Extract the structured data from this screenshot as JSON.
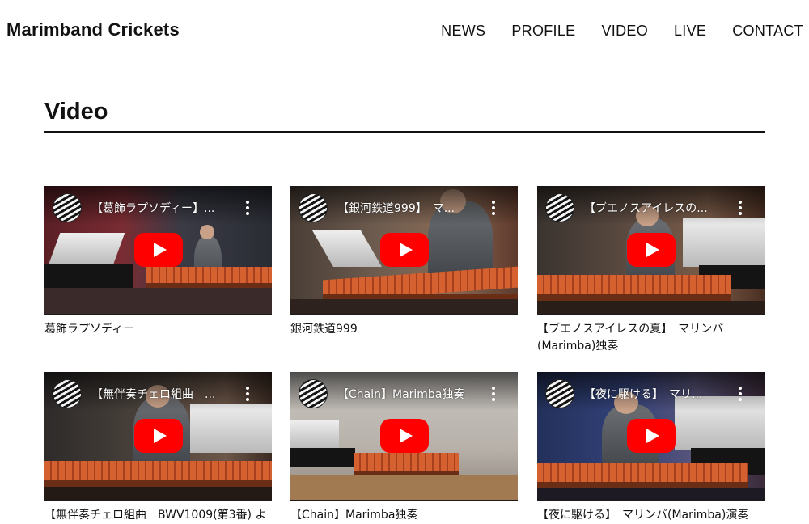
{
  "site": {
    "title": "Marimband Crickets"
  },
  "nav": [
    "NEWS",
    "PROFILE",
    "VIDEO",
    "LIVE",
    "CONTACT"
  ],
  "page": {
    "heading": "Video"
  },
  "videos": [
    {
      "overlay_title": "【葛飾ラプソディー】...",
      "caption": "葛飾ラプソディー"
    },
    {
      "overlay_title": "【銀河鉄道999】　マ...",
      "caption": "銀河鉄道999"
    },
    {
      "overlay_title": "【ブエノスアイレスの...",
      "caption": "【ブエノスアイレスの夏】　マリンバ(Marimba)独奏"
    },
    {
      "overlay_title": "【無伴奏チェロ組曲　...",
      "caption": "【無伴奏チェロ組曲　BWV1009(第3番) よ"
    },
    {
      "overlay_title": "【Chain】Marimba独奏",
      "caption": "【Chain】Marimba独奏"
    },
    {
      "overlay_title": "【夜に駆ける】　マリ...",
      "caption": "【夜に駆ける】　マリンバ(Marimba)演奏"
    }
  ],
  "colors": {
    "accent": "#ff0000",
    "text": "#111111",
    "background": "#ffffff"
  },
  "icons": {
    "channel": "channel-avatar-icon",
    "menu": "more-vertical-icon",
    "play": "play-icon"
  }
}
